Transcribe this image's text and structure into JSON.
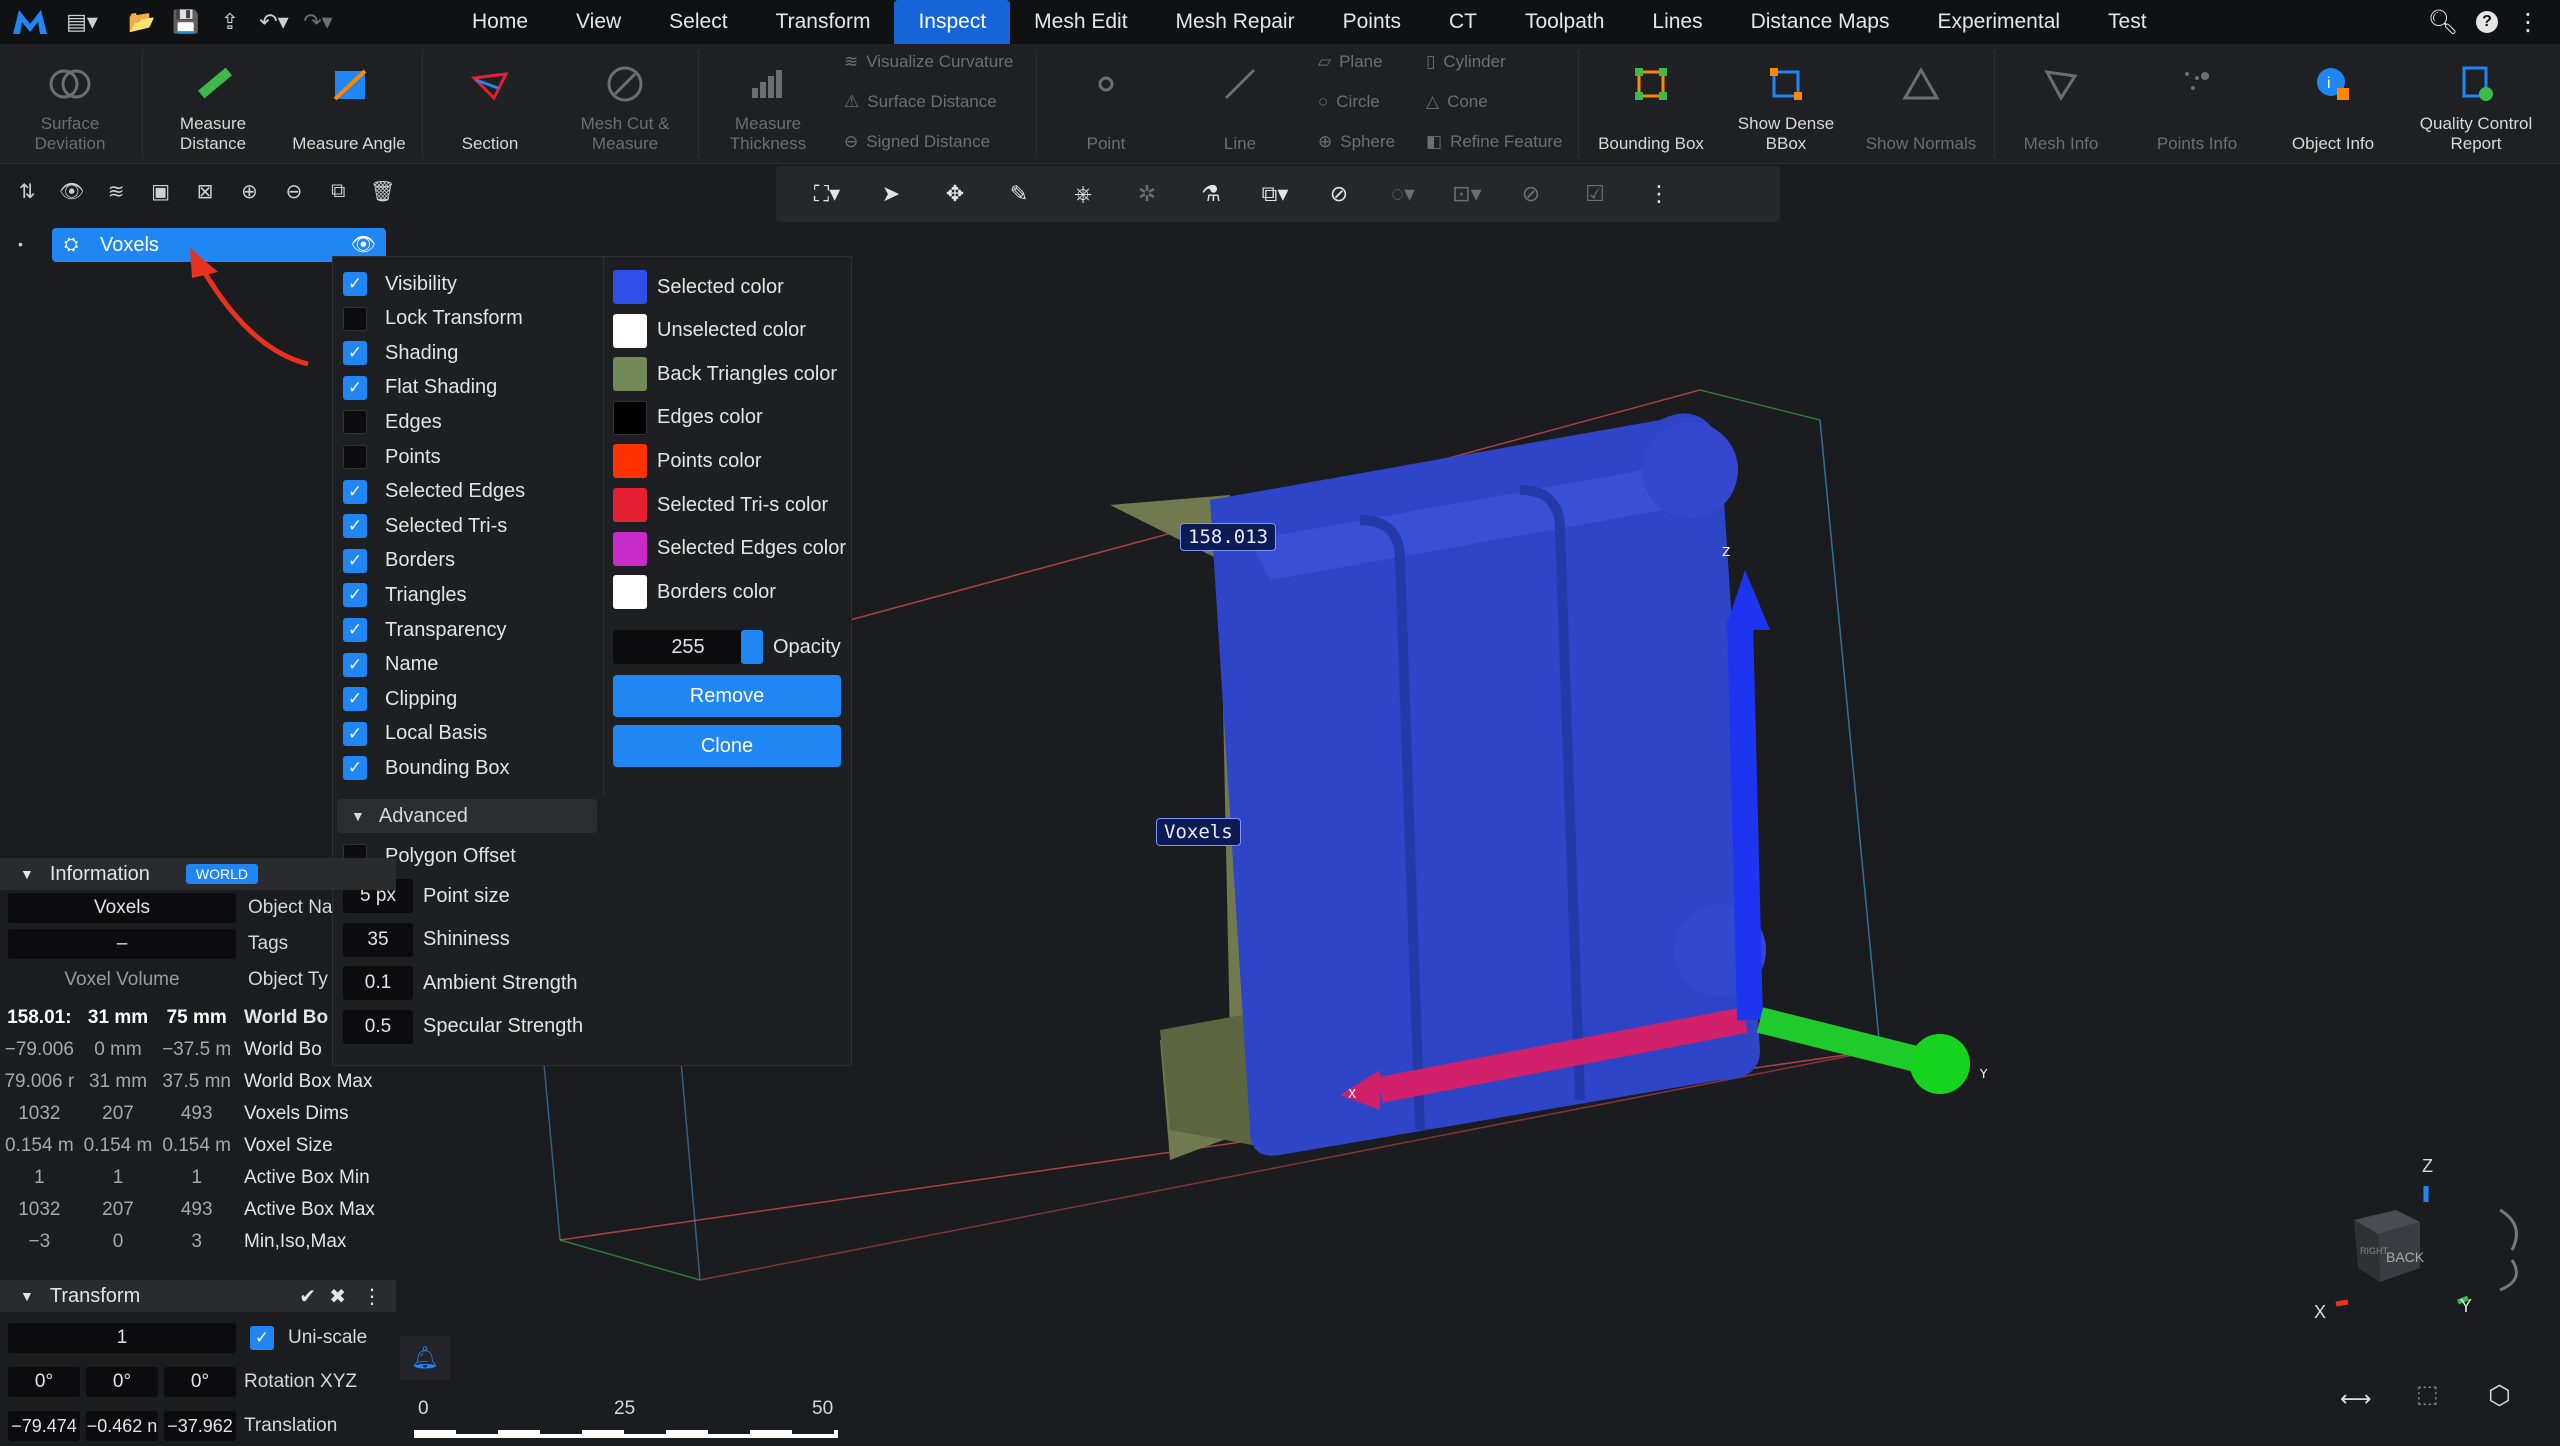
{
  "app": {
    "logo": "app-logo"
  },
  "menu": {
    "tabs": [
      "Home",
      "View",
      "Select",
      "Transform",
      "Inspect",
      "Mesh Edit",
      "Mesh Repair",
      "Points",
      "CT",
      "Toolpath",
      "Lines",
      "Distance Maps",
      "Experimental",
      "Test"
    ],
    "active": "Inspect"
  },
  "ribbon": {
    "surface_deviation": "Surface Deviation",
    "measure_distance": "Measure Distance",
    "measure_angle": "Measure Angle",
    "section": "Section",
    "mesh_cut_measure": "Mesh Cut & Measure",
    "measure_thickness": "Measure Thickness",
    "visualize_curvature": "Visualize Curvature",
    "surface_distance": "Surface Distance",
    "signed_distance": "Signed Distance",
    "point": "Point",
    "line": "Line",
    "plane": "Plane",
    "circle": "Circle",
    "sphere": "Sphere",
    "cylinder": "Cylinder",
    "cone": "Cone",
    "refine_feature": "Refine Feature",
    "bounding_box": "Bounding Box",
    "show_dense_bbox": "Show Dense BBox",
    "show_normals": "Show Normals",
    "mesh_info": "Mesh Info",
    "points_info": "Points Info",
    "object_info": "Object Info",
    "quality_control_report": "Quality Control Report"
  },
  "tree": {
    "item": "Voxels"
  },
  "popup": {
    "checkboxes": [
      {
        "label": "Visibility",
        "checked": true
      },
      {
        "label": "Lock Transform",
        "checked": false
      },
      {
        "label": "Shading",
        "checked": true
      },
      {
        "label": "Flat Shading",
        "checked": true
      },
      {
        "label": "Edges",
        "checked": false
      },
      {
        "label": "Points",
        "checked": false
      },
      {
        "label": "Selected Edges",
        "checked": true
      },
      {
        "label": "Selected Tri-s",
        "checked": true
      },
      {
        "label": "Borders",
        "checked": true
      },
      {
        "label": "Triangles",
        "checked": true
      },
      {
        "label": "Transparency",
        "checked": true
      },
      {
        "label": "Name",
        "checked": true
      },
      {
        "label": "Clipping",
        "checked": true
      },
      {
        "label": "Local Basis",
        "checked": true
      },
      {
        "label": "Bounding Box",
        "checked": true
      }
    ],
    "colors": [
      {
        "label": "Selected color",
        "color": "#2f4fe8"
      },
      {
        "label": "Unselected color",
        "color": "#ffffff"
      },
      {
        "label": "Back Triangles color",
        "color": "#728a55"
      },
      {
        "label": "Edges color",
        "color": "#000000"
      },
      {
        "label": "Points color",
        "color": "#ff3300"
      },
      {
        "label": "Selected Tri-s color",
        "color": "#e52030"
      },
      {
        "label": "Selected Edges color",
        "color": "#c82bc8"
      },
      {
        "label": "Borders color",
        "color": "#ffffff"
      }
    ],
    "opacity_value": "255",
    "opacity_label": "Opacity",
    "remove": "Remove",
    "clone": "Clone",
    "advanced": "Advanced",
    "polygon_offset": "Polygon Offset",
    "numeric": [
      {
        "value": "5 px",
        "label": "Point size"
      },
      {
        "value": "35",
        "label": "Shininess"
      },
      {
        "value": "0.1",
        "label": "Ambient Strength"
      },
      {
        "value": "0.5",
        "label": "Specular Strength"
      }
    ]
  },
  "information": {
    "title": "Information",
    "badge": "WORLD",
    "object_name_value": "Voxels",
    "object_name_label": "Object Na",
    "tags_value": "–",
    "tags_label": "Tags",
    "type_value": "Voxel Volume",
    "type_label": "Object Ty",
    "rows": [
      {
        "c": [
          "158.01:",
          "31 mm",
          "75 mm"
        ],
        "label": "World Bo",
        "bold": true
      },
      {
        "c": [
          "−79.006",
          "0 mm",
          "−37.5 m"
        ],
        "label": "World Bo"
      },
      {
        "c": [
          "79.006 r",
          "31 mm",
          "37.5 mn"
        ],
        "label": "World Box Max"
      },
      {
        "c": [
          "1032",
          "207",
          "493"
        ],
        "label": "Voxels Dims"
      },
      {
        "c": [
          "0.154 m",
          "0.154 m",
          "0.154 m"
        ],
        "label": "Voxel Size"
      },
      {
        "c": [
          "1",
          "1",
          "1"
        ],
        "label": "Active Box Min"
      },
      {
        "c": [
          "1032",
          "207",
          "493"
        ],
        "label": "Active Box Max"
      },
      {
        "c": [
          "−3",
          "0",
          "3"
        ],
        "label": "Min,Iso,Max"
      }
    ]
  },
  "transform": {
    "title": "Transform",
    "scale": "1",
    "uniscale": "Uni-scale",
    "rotation": [
      "0°",
      "0°",
      "0°"
    ],
    "rotation_label": "Rotation XYZ",
    "translation": [
      "−79.474",
      "−0.462 n",
      "−37.962"
    ],
    "translation_label": "Translation"
  },
  "viewport": {
    "dimension_label": "158.013",
    "object_label": "Voxels",
    "axis_z": "Z",
    "axis_x": "X",
    "axis_y": "Y",
    "cube_back": "BACK",
    "cube_right": "RIGHT"
  },
  "ruler": {
    "t0": "0",
    "t1": "25",
    "t2": "50"
  }
}
